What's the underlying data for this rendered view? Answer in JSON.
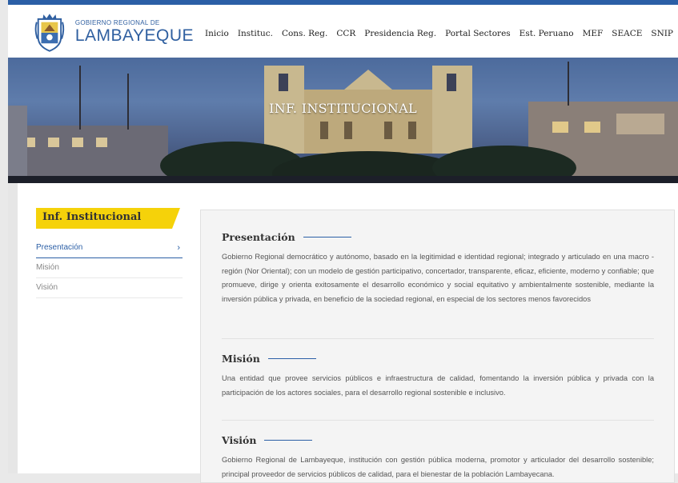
{
  "header": {
    "logo_small": "GOBIERNO REGIONAL DE",
    "logo_big": "LAMBAYEQUE",
    "nav": [
      "Inicio",
      "Instituc.",
      "Cons. Reg.",
      "CCR",
      "Presidencia Reg.",
      "Portal Sectores",
      "Est. Peruano",
      "MEF",
      "SEACE",
      "SNIP"
    ]
  },
  "banner": {
    "title": "INF. INSTITUCIONAL"
  },
  "sidebar": {
    "title": "Inf. Institucional",
    "items": [
      {
        "label": "Presentación",
        "active": true
      },
      {
        "label": "Misión",
        "active": false
      },
      {
        "label": "Visión",
        "active": false
      }
    ]
  },
  "content": {
    "sections": [
      {
        "title": "Presentación",
        "body": "Gobierno Regional democrático y autónomo, basado en la legitimidad e identidad regional; integrado y articulado en una macro - región (Nor Oriental); con un modelo de gestión participativo, concertador, transparente, eficaz, eficiente, moderno y confiable; que promueve, dirige y orienta exitosamente el desarrollo económico y social equitativo y ambientalmente sostenible, mediante la inversión pública y privada, en beneficio de la sociedad regional, en especial de los sectores menos favorecidos"
      },
      {
        "title": "Misión",
        "body": "Una entidad que provee servicios públicos e infraestructura de calidad, fomentando la inversión pública y privada con la participación de los actores sociales, para el desarrollo regional sostenible e inclusivo."
      },
      {
        "title": "Visión",
        "body": "Gobierno Regional de Lambayeque, institución con gestión pública moderna, promotor y articulador del desarrollo sostenible; principal proveedor de servicios públicos de calidad, para el bienestar de la población Lambayecana."
      }
    ]
  },
  "colors": {
    "accent": "#2b5fa6",
    "highlight": "#f5d20a"
  }
}
